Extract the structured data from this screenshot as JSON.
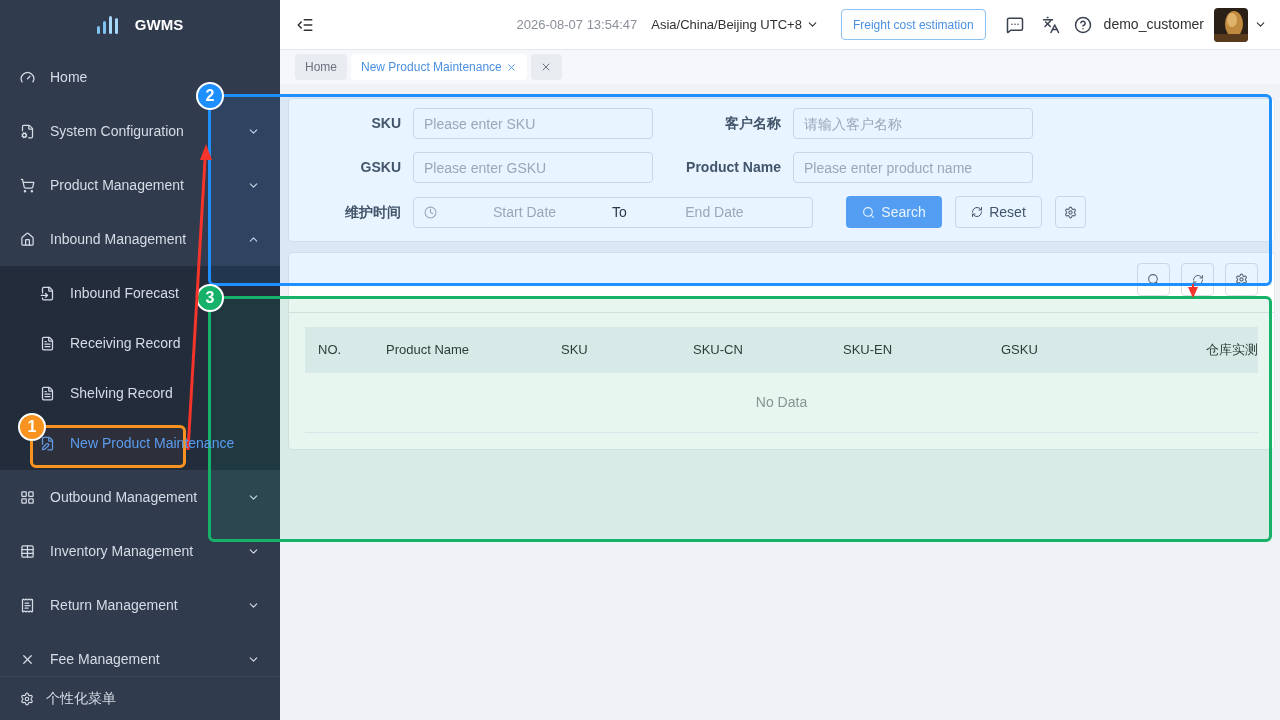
{
  "logo": {
    "text": "GWMS"
  },
  "sidebar": {
    "items": [
      {
        "label": "Home",
        "kind": "item",
        "selected": false
      },
      {
        "label": "System Configuration",
        "kind": "group",
        "expanded": false
      },
      {
        "label": "Product Management",
        "kind": "group",
        "expanded": false
      },
      {
        "label": "Inbound Management",
        "kind": "group",
        "expanded": true,
        "children": [
          {
            "label": "Inbound Forecast",
            "selected": false
          },
          {
            "label": "Receiving Record",
            "selected": false
          },
          {
            "label": "Shelving Record",
            "selected": false
          },
          {
            "label": "New Product Maintenance",
            "selected": true
          }
        ]
      },
      {
        "label": "Outbound Management",
        "kind": "group",
        "expanded": false
      },
      {
        "label": "Inventory Management",
        "kind": "group",
        "expanded": false
      },
      {
        "label": "Return Management",
        "kind": "group",
        "expanded": false
      },
      {
        "label": "Fee Management",
        "kind": "group",
        "expanded": false
      }
    ],
    "footer": "个性化菜单"
  },
  "header": {
    "datetime": "2026-08-07 13:54:47",
    "timezone": "Asia/China/Beijing UTC+8",
    "freight_button": "Freight cost estimation",
    "username": "demo_customer"
  },
  "tabs": [
    {
      "label": "Home",
      "selected": false,
      "closable": false
    },
    {
      "label": "New Product Maintenance",
      "selected": true,
      "closable": true
    }
  ],
  "search_form": {
    "rows": [
      [
        {
          "label": "SKU",
          "placeholder": "Please enter SKU"
        },
        {
          "label": "客户名称",
          "placeholder": "请输入客户名称"
        }
      ],
      [
        {
          "label": "GSKU",
          "placeholder": "Please enter GSKU"
        },
        {
          "label": "Product Name",
          "placeholder": "Please enter product name"
        }
      ]
    ],
    "date_range": {
      "label": "维护时间",
      "start_placeholder": "Start Date",
      "separator": "To",
      "end_placeholder": "End Date"
    },
    "search_button": "Search",
    "reset_button": "Reset"
  },
  "table": {
    "columns": [
      "NO.",
      "Product Name",
      "SKU",
      "SKU-CN",
      "SKU-EN",
      "GSKU",
      "仓库实测"
    ],
    "empty_text": "No Data"
  },
  "annotations": [
    {
      "label": "1",
      "color": "#f7931e"
    },
    {
      "label": "2",
      "color": "#1e8fff"
    },
    {
      "label": "3",
      "color": "#17b26a"
    }
  ]
}
